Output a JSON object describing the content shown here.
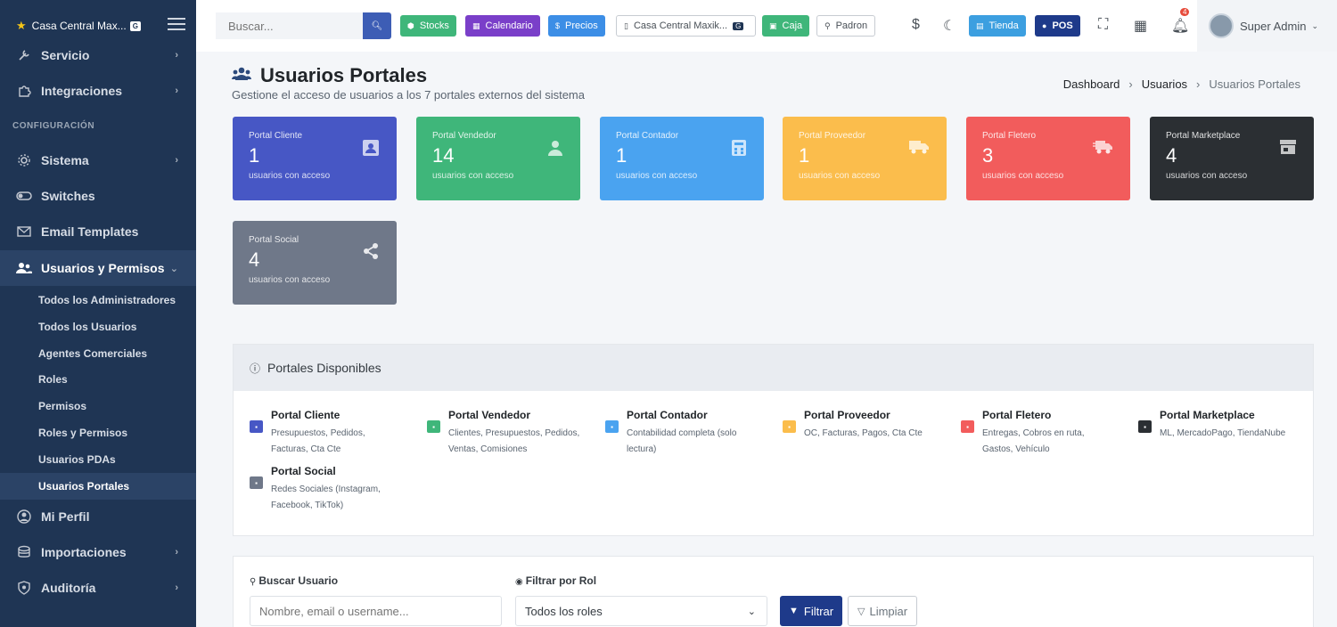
{
  "brand": {
    "name": "Casa Central Max...",
    "badge": "G"
  },
  "sidebar": {
    "section_header": "CONFIGURACIÓN",
    "items": [
      {
        "label": "Servicio",
        "icon": "wrench-icon"
      },
      {
        "label": "Integraciones",
        "icon": "puzzle-icon"
      },
      {
        "label": "Sistema",
        "icon": "gear-icon"
      },
      {
        "label": "Switches",
        "icon": "toggle-icon"
      },
      {
        "label": "Email Templates",
        "icon": "envelope-icon"
      },
      {
        "label": "Usuarios y Permisos",
        "icon": "users-icon"
      },
      {
        "label": "Mi Perfil",
        "icon": "user-circle-icon"
      },
      {
        "label": "Importaciones",
        "icon": "database-icon"
      },
      {
        "label": "Auditoría",
        "icon": "shield-icon"
      }
    ],
    "subitems": [
      "Todos los Administradores",
      "Todos los Usuarios",
      "Agentes Comerciales",
      "Roles",
      "Permisos",
      "Roles y Permisos",
      "Usuarios PDAs",
      "Usuarios Portales"
    ]
  },
  "topnav": {
    "search_placeholder": "Buscar...",
    "buttons": {
      "stocks": "Stocks",
      "calendario": "Calendario",
      "precios": "Precios",
      "sucursal": "Casa Central Maxik...",
      "sucursal_badge": "G",
      "caja": "Caja",
      "padron": "Padron",
      "tienda": "Tienda",
      "pos": "POS"
    },
    "notifications_count": "4",
    "user_name": "Super Admin"
  },
  "page": {
    "title": "Usuarios Portales",
    "subtitle": "Gestione el acceso de usuarios a los 7 portales externos del sistema",
    "breadcrumb": {
      "home": "Dashboard",
      "parent": "Usuarios",
      "current": "Usuarios Portales"
    }
  },
  "stats": [
    {
      "label": "Portal Cliente",
      "value": "1",
      "foot": "usuarios con acceso",
      "color": "#4757c5",
      "icon": "id-card-icon"
    },
    {
      "label": "Portal Vendedor",
      "value": "14",
      "foot": "usuarios con acceso",
      "color": "#3fb67a",
      "icon": "user-tie-icon"
    },
    {
      "label": "Portal Contador",
      "value": "1",
      "foot": "usuarios con acceso",
      "color": "#4aa3f0",
      "icon": "calculator-icon"
    },
    {
      "label": "Portal Proveedor",
      "value": "1",
      "foot": "usuarios con acceso",
      "color": "#fbbd4c",
      "icon": "truck-icon"
    },
    {
      "label": "Portal Fletero",
      "value": "3",
      "foot": "usuarios con acceso",
      "color": "#f25c5c",
      "icon": "shipping-fast-icon"
    },
    {
      "label": "Portal Marketplace",
      "value": "4",
      "foot": "usuarios con acceso",
      "color": "#2b2f33",
      "icon": "store-icon"
    },
    {
      "label": "Portal Social",
      "value": "4",
      "foot": "usuarios con acceso",
      "color": "#6f7889",
      "icon": "share-icon"
    }
  ],
  "portales": {
    "title": "Portales Disponibles",
    "items": [
      {
        "name": "Portal Cliente",
        "desc": "Presupuestos, Pedidos, Facturas, Cta Cte",
        "color": "#4757c5"
      },
      {
        "name": "Portal Vendedor",
        "desc": "Clientes, Presupuestos, Pedidos, Ventas, Comisiones",
        "color": "#3fb67a"
      },
      {
        "name": "Portal Contador",
        "desc": "Contabilidad completa (solo lectura)",
        "color": "#4aa3f0"
      },
      {
        "name": "Portal Proveedor",
        "desc": "OC, Facturas, Pagos, Cta Cte",
        "color": "#fbbd4c"
      },
      {
        "name": "Portal Fletero",
        "desc": "Entregas, Cobros en ruta, Gastos, Vehículo",
        "color": "#f25c5c"
      },
      {
        "name": "Portal Marketplace",
        "desc": "ML, MercadoPago, TiendaNube",
        "color": "#2b2f33"
      },
      {
        "name": "Portal Social",
        "desc": "Redes Sociales (Instagram, Facebook, TikTok)",
        "color": "#6f7889"
      }
    ]
  },
  "filters": {
    "search_label": "Buscar Usuario",
    "search_placeholder": "Nombre, email o username...",
    "role_label": "Filtrar por Rol",
    "role_selected": "Todos los roles",
    "filter_button": "Filtrar",
    "clear_button": "Limpiar"
  }
}
